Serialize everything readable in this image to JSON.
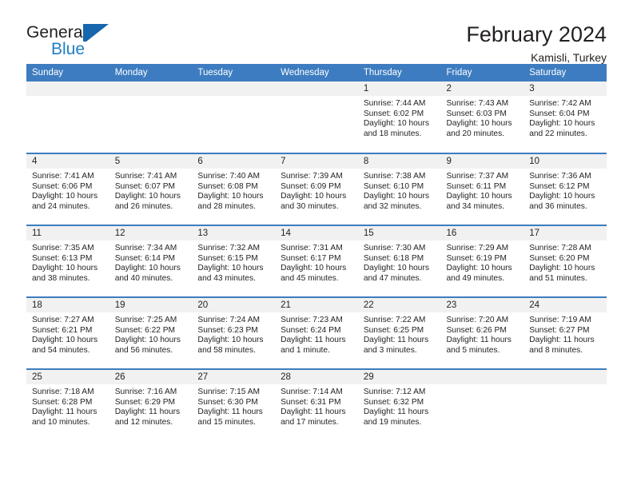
{
  "brand": {
    "name_top": "General",
    "name_bottom": "Blue",
    "flag_icon": "blue-flag-triangle-icon",
    "color_blue": "#1667ad",
    "color_text": "#231f20"
  },
  "header": {
    "title": "February 2024",
    "subtitle": "Kamisli, Turkey"
  },
  "theme": {
    "header_blue": "#3d7cc0",
    "daynum_band": "#f1f1f1",
    "text": "#231f20"
  },
  "calendar": {
    "weekday_headers": [
      "Sunday",
      "Monday",
      "Tuesday",
      "Wednesday",
      "Thursday",
      "Friday",
      "Saturday"
    ],
    "weeks": [
      [
        {
          "day": "",
          "empty": true
        },
        {
          "day": "",
          "empty": true
        },
        {
          "day": "",
          "empty": true
        },
        {
          "day": "",
          "empty": true
        },
        {
          "day": "1",
          "sunrise": "Sunrise: 7:44 AM",
          "sunset": "Sunset: 6:02 PM",
          "daylight": "Daylight: 10 hours and 18 minutes."
        },
        {
          "day": "2",
          "sunrise": "Sunrise: 7:43 AM",
          "sunset": "Sunset: 6:03 PM",
          "daylight": "Daylight: 10 hours and 20 minutes."
        },
        {
          "day": "3",
          "sunrise": "Sunrise: 7:42 AM",
          "sunset": "Sunset: 6:04 PM",
          "daylight": "Daylight: 10 hours and 22 minutes."
        }
      ],
      [
        {
          "day": "4",
          "sunrise": "Sunrise: 7:41 AM",
          "sunset": "Sunset: 6:06 PM",
          "daylight": "Daylight: 10 hours and 24 minutes."
        },
        {
          "day": "5",
          "sunrise": "Sunrise: 7:41 AM",
          "sunset": "Sunset: 6:07 PM",
          "daylight": "Daylight: 10 hours and 26 minutes."
        },
        {
          "day": "6",
          "sunrise": "Sunrise: 7:40 AM",
          "sunset": "Sunset: 6:08 PM",
          "daylight": "Daylight: 10 hours and 28 minutes."
        },
        {
          "day": "7",
          "sunrise": "Sunrise: 7:39 AM",
          "sunset": "Sunset: 6:09 PM",
          "daylight": "Daylight: 10 hours and 30 minutes."
        },
        {
          "day": "8",
          "sunrise": "Sunrise: 7:38 AM",
          "sunset": "Sunset: 6:10 PM",
          "daylight": "Daylight: 10 hours and 32 minutes."
        },
        {
          "day": "9",
          "sunrise": "Sunrise: 7:37 AM",
          "sunset": "Sunset: 6:11 PM",
          "daylight": "Daylight: 10 hours and 34 minutes."
        },
        {
          "day": "10",
          "sunrise": "Sunrise: 7:36 AM",
          "sunset": "Sunset: 6:12 PM",
          "daylight": "Daylight: 10 hours and 36 minutes."
        }
      ],
      [
        {
          "day": "11",
          "sunrise": "Sunrise: 7:35 AM",
          "sunset": "Sunset: 6:13 PM",
          "daylight": "Daylight: 10 hours and 38 minutes."
        },
        {
          "day": "12",
          "sunrise": "Sunrise: 7:34 AM",
          "sunset": "Sunset: 6:14 PM",
          "daylight": "Daylight: 10 hours and 40 minutes."
        },
        {
          "day": "13",
          "sunrise": "Sunrise: 7:32 AM",
          "sunset": "Sunset: 6:15 PM",
          "daylight": "Daylight: 10 hours and 43 minutes."
        },
        {
          "day": "14",
          "sunrise": "Sunrise: 7:31 AM",
          "sunset": "Sunset: 6:17 PM",
          "daylight": "Daylight: 10 hours and 45 minutes."
        },
        {
          "day": "15",
          "sunrise": "Sunrise: 7:30 AM",
          "sunset": "Sunset: 6:18 PM",
          "daylight": "Daylight: 10 hours and 47 minutes."
        },
        {
          "day": "16",
          "sunrise": "Sunrise: 7:29 AM",
          "sunset": "Sunset: 6:19 PM",
          "daylight": "Daylight: 10 hours and 49 minutes."
        },
        {
          "day": "17",
          "sunrise": "Sunrise: 7:28 AM",
          "sunset": "Sunset: 6:20 PM",
          "daylight": "Daylight: 10 hours and 51 minutes."
        }
      ],
      [
        {
          "day": "18",
          "sunrise": "Sunrise: 7:27 AM",
          "sunset": "Sunset: 6:21 PM",
          "daylight": "Daylight: 10 hours and 54 minutes."
        },
        {
          "day": "19",
          "sunrise": "Sunrise: 7:25 AM",
          "sunset": "Sunset: 6:22 PM",
          "daylight": "Daylight: 10 hours and 56 minutes."
        },
        {
          "day": "20",
          "sunrise": "Sunrise: 7:24 AM",
          "sunset": "Sunset: 6:23 PM",
          "daylight": "Daylight: 10 hours and 58 minutes."
        },
        {
          "day": "21",
          "sunrise": "Sunrise: 7:23 AM",
          "sunset": "Sunset: 6:24 PM",
          "daylight": "Daylight: 11 hours and 1 minute."
        },
        {
          "day": "22",
          "sunrise": "Sunrise: 7:22 AM",
          "sunset": "Sunset: 6:25 PM",
          "daylight": "Daylight: 11 hours and 3 minutes."
        },
        {
          "day": "23",
          "sunrise": "Sunrise: 7:20 AM",
          "sunset": "Sunset: 6:26 PM",
          "daylight": "Daylight: 11 hours and 5 minutes."
        },
        {
          "day": "24",
          "sunrise": "Sunrise: 7:19 AM",
          "sunset": "Sunset: 6:27 PM",
          "daylight": "Daylight: 11 hours and 8 minutes."
        }
      ],
      [
        {
          "day": "25",
          "sunrise": "Sunrise: 7:18 AM",
          "sunset": "Sunset: 6:28 PM",
          "daylight": "Daylight: 11 hours and 10 minutes."
        },
        {
          "day": "26",
          "sunrise": "Sunrise: 7:16 AM",
          "sunset": "Sunset: 6:29 PM",
          "daylight": "Daylight: 11 hours and 12 minutes."
        },
        {
          "day": "27",
          "sunrise": "Sunrise: 7:15 AM",
          "sunset": "Sunset: 6:30 PM",
          "daylight": "Daylight: 11 hours and 15 minutes."
        },
        {
          "day": "28",
          "sunrise": "Sunrise: 7:14 AM",
          "sunset": "Sunset: 6:31 PM",
          "daylight": "Daylight: 11 hours and 17 minutes."
        },
        {
          "day": "29",
          "sunrise": "Sunrise: 7:12 AM",
          "sunset": "Sunset: 6:32 PM",
          "daylight": "Daylight: 11 hours and 19 minutes."
        },
        {
          "day": "",
          "empty": true
        },
        {
          "day": "",
          "empty": true
        }
      ]
    ]
  }
}
